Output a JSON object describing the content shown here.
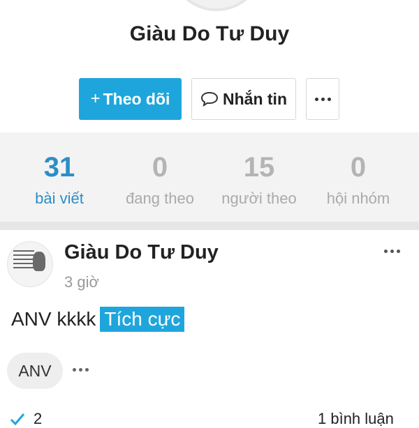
{
  "profile": {
    "name": "Giàu Do Tư Duy"
  },
  "actions": {
    "follow_label": "Theo dõi",
    "message_label": "Nhắn tin"
  },
  "stats": [
    {
      "value": "31",
      "label": "bài viết",
      "active": true
    },
    {
      "value": "0",
      "label": "đang theo",
      "active": false
    },
    {
      "value": "15",
      "label": "người theo",
      "active": false
    },
    {
      "value": "0",
      "label": "hội nhóm",
      "active": false
    }
  ],
  "post": {
    "author": "Giàu Do Tư Duy",
    "time": "3 giờ",
    "text": "ANV kkkk",
    "tag": "Tích cực",
    "topic_chip": "ANV",
    "footer_left_count": "2",
    "footer_right": "1 bình luận"
  },
  "colors": {
    "accent": "#1ea6dc",
    "stat_active": "#2b8ec7",
    "stat_inactive": "#b4b4b4"
  }
}
